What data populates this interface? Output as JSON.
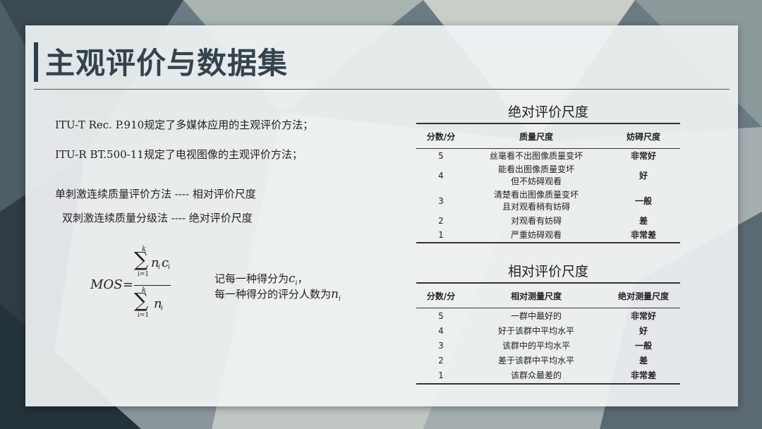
{
  "slide": {
    "title": "主观评价与数据集",
    "lines": [
      "ITU-T  Rec. P.910规定了多媒体应用的主观评价方法；",
      "ITU-R  BT.500-11规定了电视图像的主观评价方法；",
      "单刺激连续质量评价方法  ---- 相对评价尺度",
      "双刺激连续质量分级法    ---- 绝对评价尺度"
    ],
    "formula": {
      "lhs": "MOS",
      "eq": "=",
      "sum_upper": "k",
      "sum_lower": "i=1",
      "num_term": "n",
      "num_sub": "i",
      "num_term2": "c",
      "num_sub2": "i",
      "den_term": "n",
      "den_sub": "i",
      "note_line1": "记每一种得分为",
      "note_var1": "c",
      "note_sub1": "i",
      "note_comma": "，",
      "note_line2": "每一种得分的评分人数为",
      "note_var2": "n",
      "note_sub2": "i"
    }
  },
  "absolute_table": {
    "title": "绝对评价尺度",
    "headers": [
      "分数/分",
      "质量尺度",
      "妨碍尺度"
    ],
    "rows": [
      {
        "score": "5",
        "quality": [
          "丝毫看不出图像质量变坏"
        ],
        "level": "非常好"
      },
      {
        "score": "4",
        "quality": [
          "能看出图像质量变坏",
          "但不妨碍观看"
        ],
        "level": "好"
      },
      {
        "score": "3",
        "quality": [
          "清楚看出图像质量变坏",
          "且对观看稍有妨碍"
        ],
        "level": "一般"
      },
      {
        "score": "2",
        "quality": [
          "对观看有妨碍"
        ],
        "level": "差"
      },
      {
        "score": "1",
        "quality": [
          "严重妨碍观看"
        ],
        "level": "非常差"
      }
    ]
  },
  "relative_table": {
    "title": "相对评价尺度",
    "headers": [
      "分数/分",
      "相对测量尺度",
      "绝对测量尺度"
    ],
    "rows": [
      {
        "score": "5",
        "quality": [
          "一群中最好的"
        ],
        "level": "非常好"
      },
      {
        "score": "4",
        "quality": [
          "好于该群中平均水平"
        ],
        "level": "好"
      },
      {
        "score": "3",
        "quality": [
          "该群中的平均水平"
        ],
        "level": "一般"
      },
      {
        "score": "2",
        "quality": [
          "差于该群中平均水平"
        ],
        "level": "差"
      },
      {
        "score": "1",
        "quality": [
          "该群众最差的"
        ],
        "level": "非常差"
      }
    ]
  },
  "colors": {
    "accent": "#2e3e47",
    "background": "#5e6f78"
  }
}
